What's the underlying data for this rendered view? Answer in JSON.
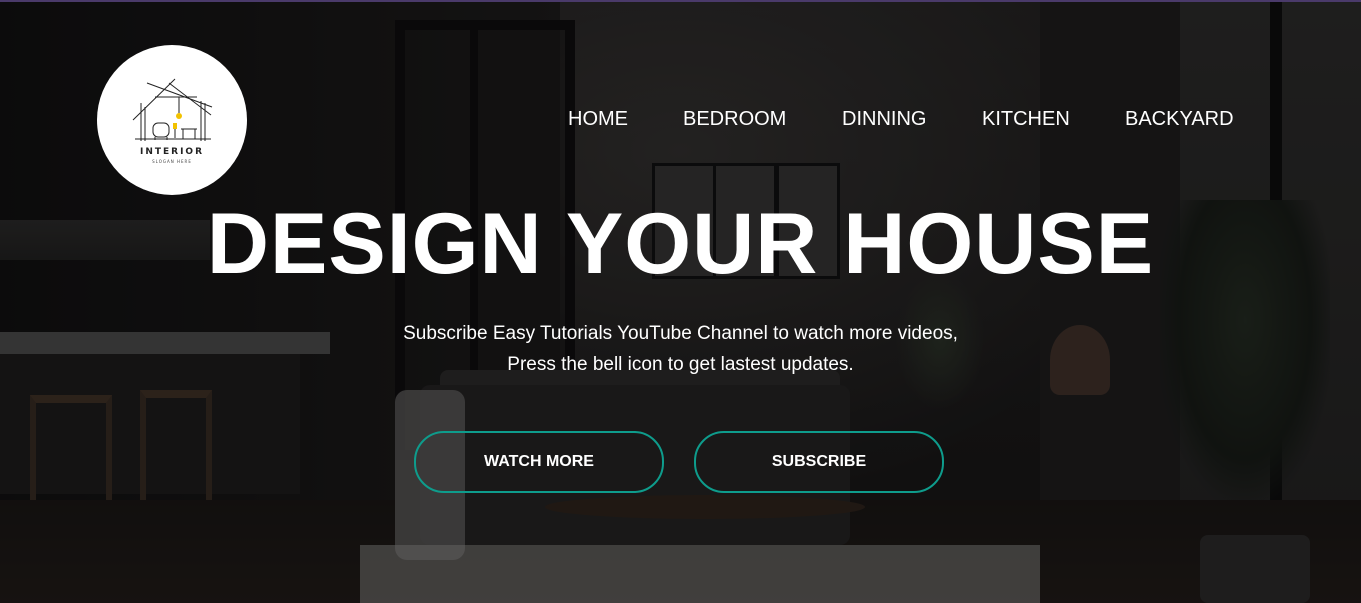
{
  "brand": {
    "logo_title": "INTERIOR",
    "logo_slogan": "SLOGAN HERE"
  },
  "nav": {
    "items": [
      {
        "label": "HOME"
      },
      {
        "label": "BEDROOM"
      },
      {
        "label": "DINNING"
      },
      {
        "label": "KITCHEN"
      },
      {
        "label": "BACKYARD"
      }
    ]
  },
  "hero": {
    "headline": "DESIGN YOUR HOUSE",
    "subtext_line1": "Subscribe Easy Tutorials YouTube Channel to watch more videos,",
    "subtext_line2": "Press the bell icon to get lastest updates.",
    "buttons": {
      "watch_more": "WATCH MORE",
      "subscribe": "SUBSCRIBE"
    },
    "button_border_color": "#0e9c8c"
  },
  "icons": {
    "logo": "house-outline-icon"
  }
}
